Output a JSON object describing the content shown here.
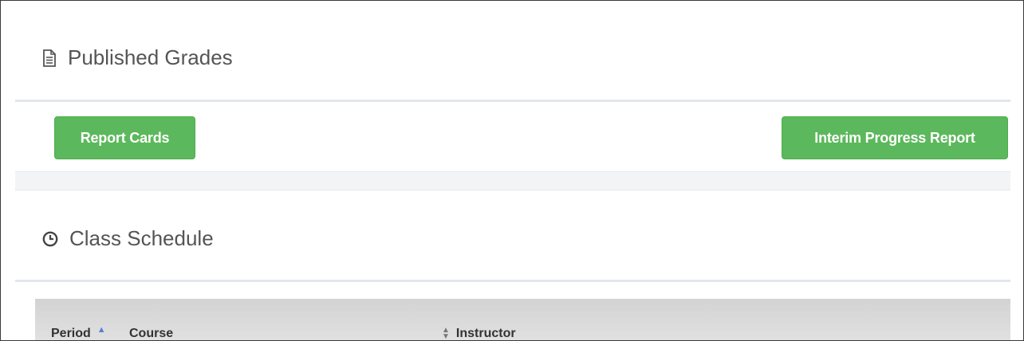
{
  "published_grades": {
    "title": "Published Grades",
    "icon": "document-icon",
    "buttons": {
      "report_cards": "Report Cards",
      "interim_progress": "Interim Progress Report"
    },
    "button_color": "#5cb85c"
  },
  "class_schedule": {
    "title": "Class Schedule",
    "icon": "clock-icon",
    "columns": [
      "Period",
      "Course",
      "Instructor"
    ],
    "sort": {
      "period": "ascending"
    }
  }
}
